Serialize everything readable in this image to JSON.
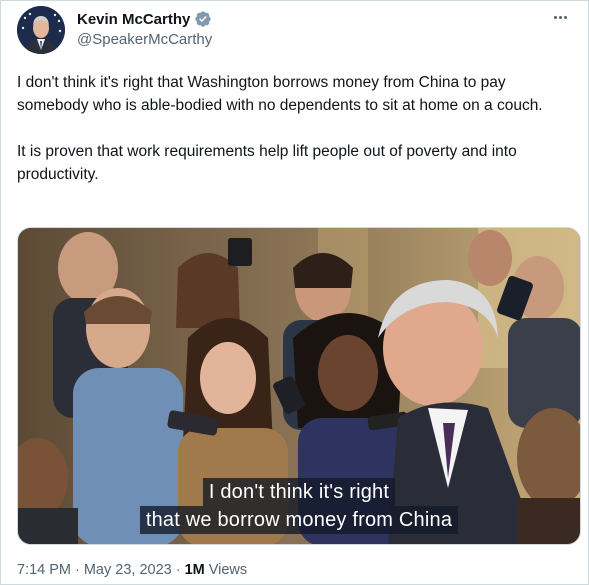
{
  "author": {
    "name": "Kevin McCarthy",
    "handle": "@SpeakerMcCarthy",
    "verified": true
  },
  "tweet": {
    "text": "I don't think it's right that Washington borrows money from China to pay somebody who is able-bodied with no dependents to sit at home on a couch.\n\nIt is proven that work requirements help lift people out of poverty and into productivity."
  },
  "media": {
    "caption_line1": "I don't think it's right",
    "caption_line2": "that we borrow money from China"
  },
  "meta": {
    "time": "7:14 PM",
    "separator1": "·",
    "date": "May 23, 2023",
    "separator2": "·",
    "views_count": "1M",
    "views_label": "Views"
  },
  "colors": {
    "verified_badge": "#829aab",
    "secondary_text": "#536471",
    "primary_text": "#0f1419",
    "border": "#cfd9de"
  }
}
